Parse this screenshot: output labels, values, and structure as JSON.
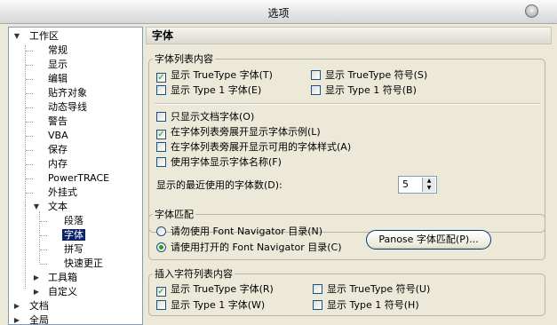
{
  "window": {
    "title": "选项"
  },
  "tree": {
    "items": [
      {
        "label": "工作区"
      },
      {
        "label": "常规"
      },
      {
        "label": "显示"
      },
      {
        "label": "编辑"
      },
      {
        "label": "贴齐对象"
      },
      {
        "label": "动态导线"
      },
      {
        "label": "警告"
      },
      {
        "label": "VBA"
      },
      {
        "label": "保存"
      },
      {
        "label": "内存"
      },
      {
        "label": "PowerTRACE"
      },
      {
        "label": "外挂式"
      },
      {
        "label": "文本"
      },
      {
        "label": "段落"
      },
      {
        "label": "字体"
      },
      {
        "label": "拼写"
      },
      {
        "label": "快速更正"
      },
      {
        "label": "工具箱"
      },
      {
        "label": "自定义"
      },
      {
        "label": "文档"
      },
      {
        "label": "全局"
      }
    ],
    "selected": "字体"
  },
  "panel": {
    "header": "字体",
    "font_list": {
      "legend": "字体列表内容",
      "show_truetype_fonts": {
        "label": "显示 TrueType 字体(T)",
        "checked": true
      },
      "show_truetype_symbols": {
        "label": "显示 TrueType 符号(S)",
        "checked": false
      },
      "show_type1_fonts": {
        "label": "显示 Type 1 字体(E)",
        "checked": false
      },
      "show_type1_symbols": {
        "label": "显示 Type 1 符号(B)",
        "checked": false
      },
      "only_document_fonts": {
        "label": "只显示文档字体(O)",
        "checked": false
      },
      "show_font_samples": {
        "label": "在字体列表旁展开显示字体示例(L)",
        "checked": true
      },
      "show_available_styles": {
        "label": "在字体列表旁展开显示可用的字体样式(A)",
        "checked": false
      },
      "use_font_to_show_name": {
        "label": "使用字体显示字体名称(F)",
        "checked": false
      },
      "recent_fonts_label": "显示的最近使用的字体数(D):",
      "recent_fonts_value": "5"
    },
    "font_matching": {
      "legend": "字体匹配",
      "dont_use_navigator": {
        "label": "请勿使用 Font Navigator 目录(N)",
        "selected": false
      },
      "use_open_navigator": {
        "label": "请使用打开的 Font Navigator 目录(C)",
        "selected": true
      },
      "panose_button": "Panose 字体匹配(P)..."
    },
    "insert_char_list": {
      "legend": "插入字符列表内容",
      "show_truetype_fonts": {
        "label": "显示 TrueType 字体(R)",
        "checked": true
      },
      "show_truetype_symbols": {
        "label": "显示 TrueType 符号(U)",
        "checked": false
      },
      "show_type1_fonts": {
        "label": "显示 Type 1 字体(W)",
        "checked": false
      },
      "show_type1_symbols": {
        "label": "显示 Type 1 符号(H)",
        "checked": false
      }
    }
  },
  "colors": {
    "selection": "#0a246a",
    "check": "#21a121"
  }
}
